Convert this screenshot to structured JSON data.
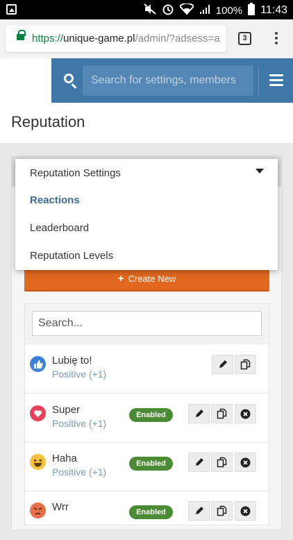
{
  "status_bar": {
    "battery": "100%",
    "time": "11:43"
  },
  "browser": {
    "url_scheme": "https://",
    "url_host": "unique-game.pl",
    "url_path": "/admin/?adsess=a",
    "tab_count": "3"
  },
  "nav": {
    "search_placeholder": "Search for settings, members"
  },
  "page": {
    "title": "Reputation"
  },
  "menu": {
    "items": [
      {
        "label": "Reputation Settings",
        "active": false
      },
      {
        "label": "Reactions",
        "active": true
      },
      {
        "label": "Leaderboard",
        "active": false
      },
      {
        "label": "Reputation Levels",
        "active": false
      }
    ]
  },
  "actions": {
    "create_label": "Create New"
  },
  "filter": {
    "placeholder": "Search..."
  },
  "reactions": [
    {
      "name": "Lubię to!",
      "value": "Positive (+1)",
      "status": "",
      "icon": "thumbs-up-icon",
      "color": "#3f7fdc"
    },
    {
      "name": "Super",
      "value": "Positive (+1)",
      "status": "Enabled",
      "icon": "heart-icon",
      "color": "#e8405a"
    },
    {
      "name": "Haha",
      "value": "Positive (+1)",
      "status": "Enabled",
      "icon": "laughing-face-icon",
      "color": "#f5c33b"
    },
    {
      "name": "Wrr",
      "value": "",
      "status": "Enabled",
      "icon": "angry-face-icon",
      "color": "#e5704a"
    }
  ],
  "colors": {
    "nav_blue": "#3f78a8",
    "create_orange": "#e2681f",
    "enabled_green": "#4b8b35",
    "active_menu": "#3f6a94"
  }
}
